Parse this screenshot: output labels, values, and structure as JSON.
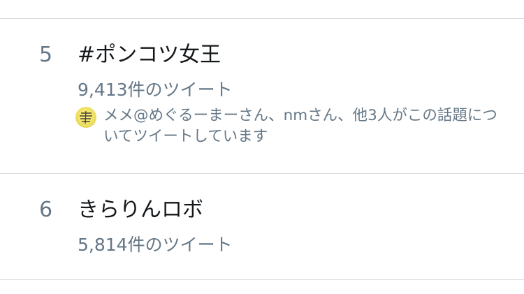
{
  "trends": [
    {
      "rank": "5",
      "title": "#ポンコツ女王",
      "tweet_count": "9,413件のツイート",
      "context": {
        "avatar_icon": "user-avatar-icon",
        "text": "メメ@めぐるーまーさん、nmさん、他3人がこの話題についてツイートしています"
      }
    },
    {
      "rank": "6",
      "title": "きらりんロボ",
      "tweet_count": "5,814件のツイート"
    }
  ],
  "colors": {
    "primary_text": "#14171a",
    "secondary_text": "#657786",
    "divider": "#d9dde0",
    "background": "#ffffff"
  }
}
